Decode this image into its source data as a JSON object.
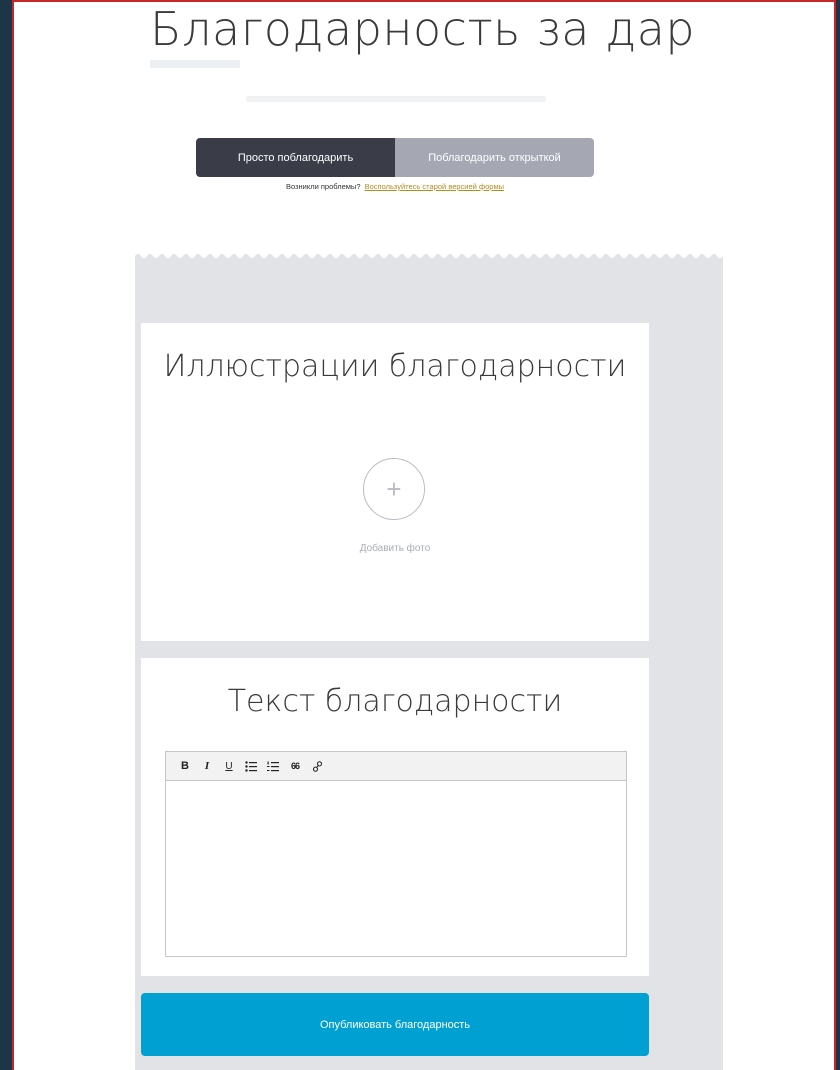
{
  "page": {
    "title": "Благодарность за дар"
  },
  "tabs": [
    {
      "label": "Просто поблагодарить",
      "active": true
    },
    {
      "label": "Поблагодарить открыткой",
      "active": false
    }
  ],
  "problems": {
    "question": "Возникли проблемы?",
    "link": "Воспользуйтесь старой версией формы"
  },
  "illustrations": {
    "heading": "Иллюстрации благодарности",
    "add_photo_label": "Добавить фото"
  },
  "text_section": {
    "heading": "Текст благодарности",
    "toolbar": [
      {
        "label": "B",
        "icon": "bold-icon"
      },
      {
        "label": "I",
        "icon": "italic-icon"
      },
      {
        "label": "U",
        "icon": "underline-icon"
      },
      {
        "label": "",
        "icon": "bullet-list-icon"
      },
      {
        "label": "",
        "icon": "numbered-list-icon"
      },
      {
        "label": "66",
        "icon": "quote-icon"
      },
      {
        "label": "",
        "icon": "link-icon"
      }
    ],
    "editor_value": ""
  },
  "publish": {
    "label": "Опубликовать благодарность"
  },
  "colors": {
    "active_tab": "#3a3d48",
    "inactive_tab": "#a5a8b3",
    "panel": "#e2e3e7",
    "publish": "#00a1d2",
    "link": "#b58a1e"
  }
}
